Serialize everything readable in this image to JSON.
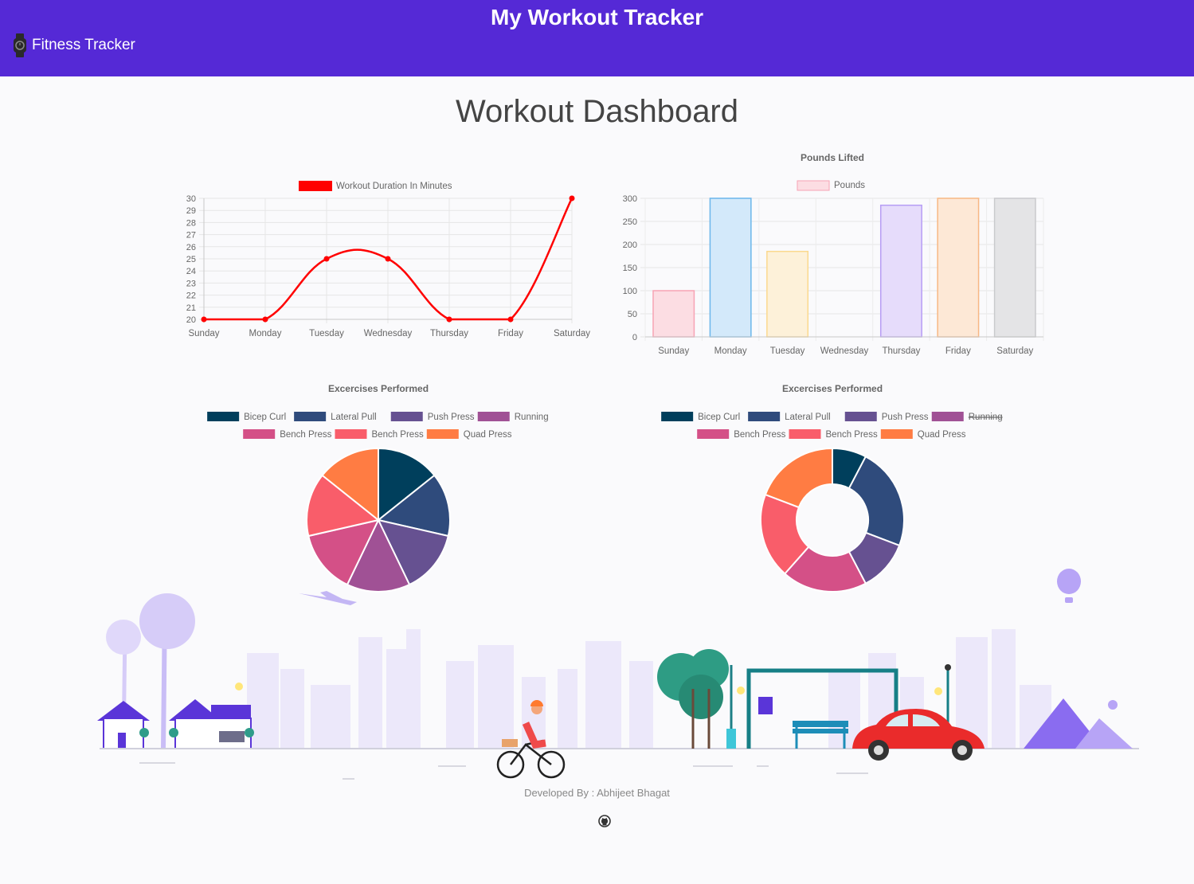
{
  "header": {
    "app_title": "My Workout Tracker",
    "brand_label": "Fitness Tracker",
    "colors": {
      "navbar": "#5529d6",
      "text": "#ffffff"
    }
  },
  "main": {
    "page_title": "Workout Dashboard"
  },
  "footer": {
    "credit": "Developed By : Abhijeet Bhagat",
    "github_icon": "github-icon"
  },
  "chart_data": [
    {
      "type": "line",
      "title": "",
      "legend": [
        "Workout Duration In Minutes"
      ],
      "categories": [
        "Sunday",
        "Monday",
        "Tuesday",
        "Wednesday",
        "Thursday",
        "Friday",
        "Saturday"
      ],
      "series": [
        {
          "name": "Workout Duration In Minutes",
          "values": [
            20,
            20,
            25,
            25,
            20,
            20,
            30
          ],
          "color": "#ff0000"
        }
      ],
      "ylim": [
        20,
        30
      ],
      "yticks": [
        20,
        21,
        22,
        23,
        24,
        25,
        26,
        27,
        28,
        29,
        30
      ],
      "grid": true,
      "legend_position": "top"
    },
    {
      "type": "bar",
      "title": "Pounds Lifted",
      "legend": [
        "Pounds"
      ],
      "categories": [
        "Sunday",
        "Monday",
        "Tuesday",
        "Wednesday",
        "Thursday",
        "Friday",
        "Saturday"
      ],
      "series": [
        {
          "name": "Pounds",
          "values": [
            100,
            300,
            185,
            0,
            285,
            300,
            300
          ]
        }
      ],
      "fill_colors": [
        "#fcdde3",
        "#d3e9fa",
        "#fdf1d9",
        "#dbf1f1",
        "#e6dcfb",
        "#fde8d6",
        "#e4e4e6"
      ],
      "border_colors": [
        "#f7a3b4",
        "#6bb6eb",
        "#fbd98e",
        "#89d0d0",
        "#b69df4",
        "#f7b784",
        "#c9cacd"
      ],
      "ylim": [
        0,
        300
      ],
      "yticks": [
        0,
        50,
        100,
        150,
        200,
        250,
        300
      ],
      "grid": true,
      "legend_position": "top"
    },
    {
      "type": "pie",
      "title": "Excercises Performed",
      "labels": [
        "Bicep Curl",
        "Lateral Pull",
        "Push Press",
        "Running",
        "Bench Press",
        "Bench Press",
        "Quad Press"
      ],
      "values": [
        1,
        1,
        1,
        1,
        1,
        1,
        1
      ],
      "colors": [
        "#003f5c",
        "#2f4b7c",
        "#665191",
        "#a05195",
        "#d45087",
        "#f95d6a",
        "#ff7c43"
      ],
      "hidden": [],
      "legend_position": "top"
    },
    {
      "type": "pie",
      "title": "Excercises Performed",
      "labels": [
        "Bicep Curl",
        "Lateral Pull",
        "Push Press",
        "Running",
        "Bench Press",
        "Bench Press",
        "Quad Press"
      ],
      "values": [
        1,
        3,
        1.5,
        0,
        2.5,
        2.5,
        2.5
      ],
      "colors": [
        "#003f5c",
        "#2f4b7c",
        "#665191",
        "#a05195",
        "#d45087",
        "#f95d6a",
        "#ff7c43"
      ],
      "hidden": [
        "Running"
      ],
      "doughnut": true,
      "legend_position": "top"
    }
  ]
}
